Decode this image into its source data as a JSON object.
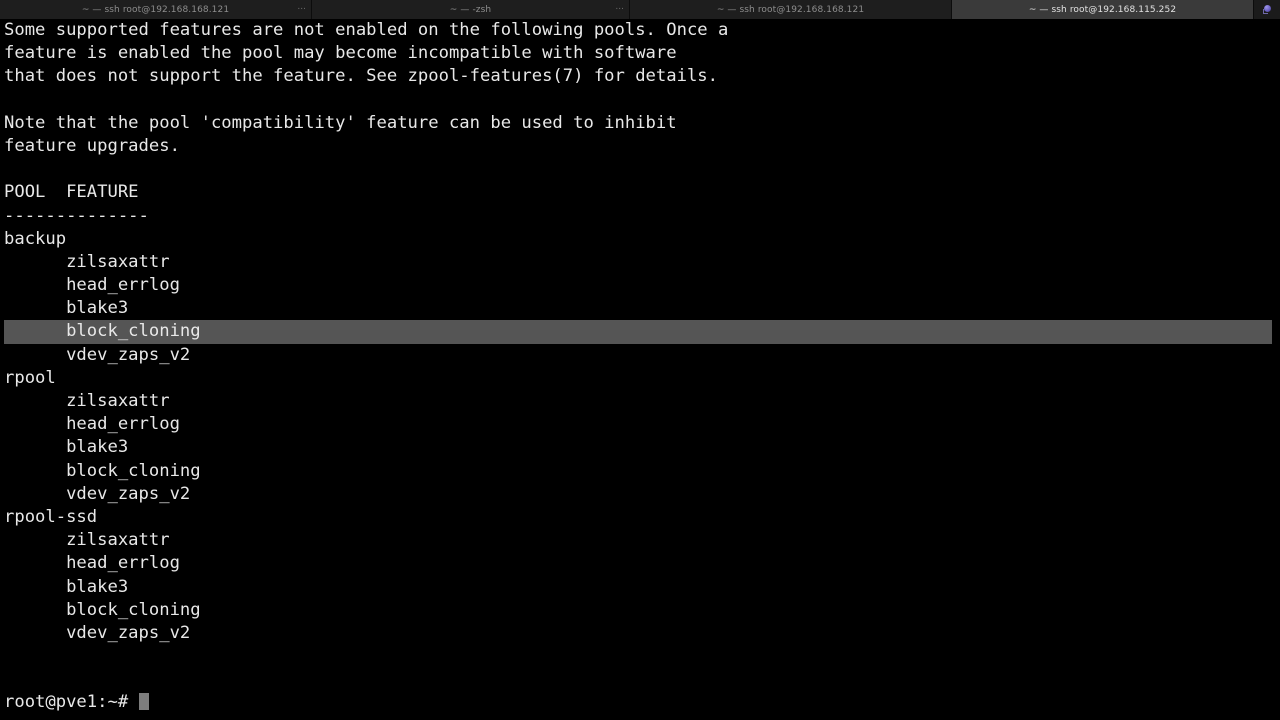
{
  "window": {
    "tabs": [
      {
        "title": "~ — ssh root@192.168.168.121",
        "active": false,
        "overflow": "···"
      },
      {
        "title": "~ — -zsh",
        "active": false,
        "overflow": "···"
      },
      {
        "title": "~ — ssh root@192.168.168.121",
        "active": false,
        "overflow": ""
      },
      {
        "title": "~ — ssh root@192.168.115.252",
        "active": true,
        "overflow": ""
      }
    ],
    "right_icon": "orb-icon",
    "colors": {
      "tab_inactive_bg": "#1e1e1e",
      "tab_active_bg": "#3a3a3a",
      "tabbar_bg": "#141414",
      "terminal_bg": "#000000",
      "terminal_fg": "#e8e8e8",
      "selection_bg": "#555555",
      "cursor_bg": "#7d7d7d"
    }
  },
  "terminal": {
    "lines": [
      {
        "text": "Some supported features are not enabled on the following pools. Once a",
        "highlight": false
      },
      {
        "text": "feature is enabled the pool may become incompatible with software",
        "highlight": false
      },
      {
        "text": "that does not support the feature. See zpool-features(7) for details.",
        "highlight": false
      },
      {
        "text": "",
        "highlight": false
      },
      {
        "text": "Note that the pool 'compatibility' feature can be used to inhibit",
        "highlight": false
      },
      {
        "text": "feature upgrades.",
        "highlight": false
      },
      {
        "text": "",
        "highlight": false
      },
      {
        "text": "POOL  FEATURE",
        "highlight": false
      },
      {
        "text": "--------------",
        "highlight": false
      },
      {
        "text": "backup",
        "highlight": false
      },
      {
        "text": "      zilsaxattr",
        "highlight": false
      },
      {
        "text": "      head_errlog",
        "highlight": false
      },
      {
        "text": "      blake3",
        "highlight": false
      },
      {
        "text": "      block_cloning",
        "highlight": true
      },
      {
        "text": "      vdev_zaps_v2",
        "highlight": false
      },
      {
        "text": "rpool",
        "highlight": false
      },
      {
        "text": "      zilsaxattr",
        "highlight": false
      },
      {
        "text": "      head_errlog",
        "highlight": false
      },
      {
        "text": "      blake3",
        "highlight": false
      },
      {
        "text": "      block_cloning",
        "highlight": false
      },
      {
        "text": "      vdev_zaps_v2",
        "highlight": false
      },
      {
        "text": "rpool-ssd",
        "highlight": false
      },
      {
        "text": "      zilsaxattr",
        "highlight": false
      },
      {
        "text": "      head_errlog",
        "highlight": false
      },
      {
        "text": "      blake3",
        "highlight": false
      },
      {
        "text": "      block_cloning",
        "highlight": false
      },
      {
        "text": "      vdev_zaps_v2",
        "highlight": false
      },
      {
        "text": "",
        "highlight": false
      },
      {
        "text": "",
        "highlight": false
      }
    ],
    "prompt": "root@pve1:~# ",
    "input_value": ""
  }
}
